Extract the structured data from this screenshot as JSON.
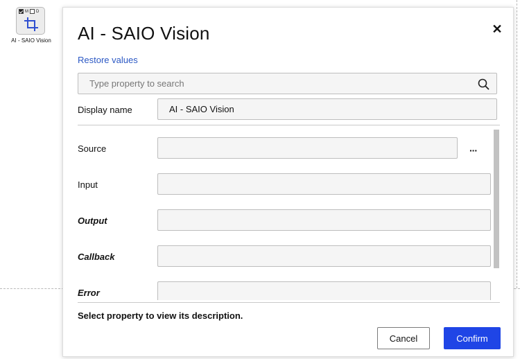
{
  "node": {
    "flag_m": "M",
    "flag_d": "D",
    "label": "AI - SAIO Vision",
    "icon": "crop-icon"
  },
  "dialog": {
    "title": "AI - SAIO Vision",
    "restore_label": "Restore values",
    "search_placeholder": "Type property to search",
    "display_name_label": "Display name",
    "display_name_value": "AI - SAIO Vision",
    "properties": [
      {
        "label": "Source",
        "value": ""
      },
      {
        "label": "Input",
        "value": ""
      },
      {
        "label": "Output",
        "value": ""
      },
      {
        "label": "Callback",
        "value": ""
      },
      {
        "label": "Error",
        "value": ""
      }
    ],
    "ellipsis_label": "···",
    "description": "Select property to view its description.",
    "cancel_label": "Cancel",
    "confirm_label": "Confirm",
    "accent_color": "#1f45e6",
    "link_color": "#2b58c4"
  }
}
